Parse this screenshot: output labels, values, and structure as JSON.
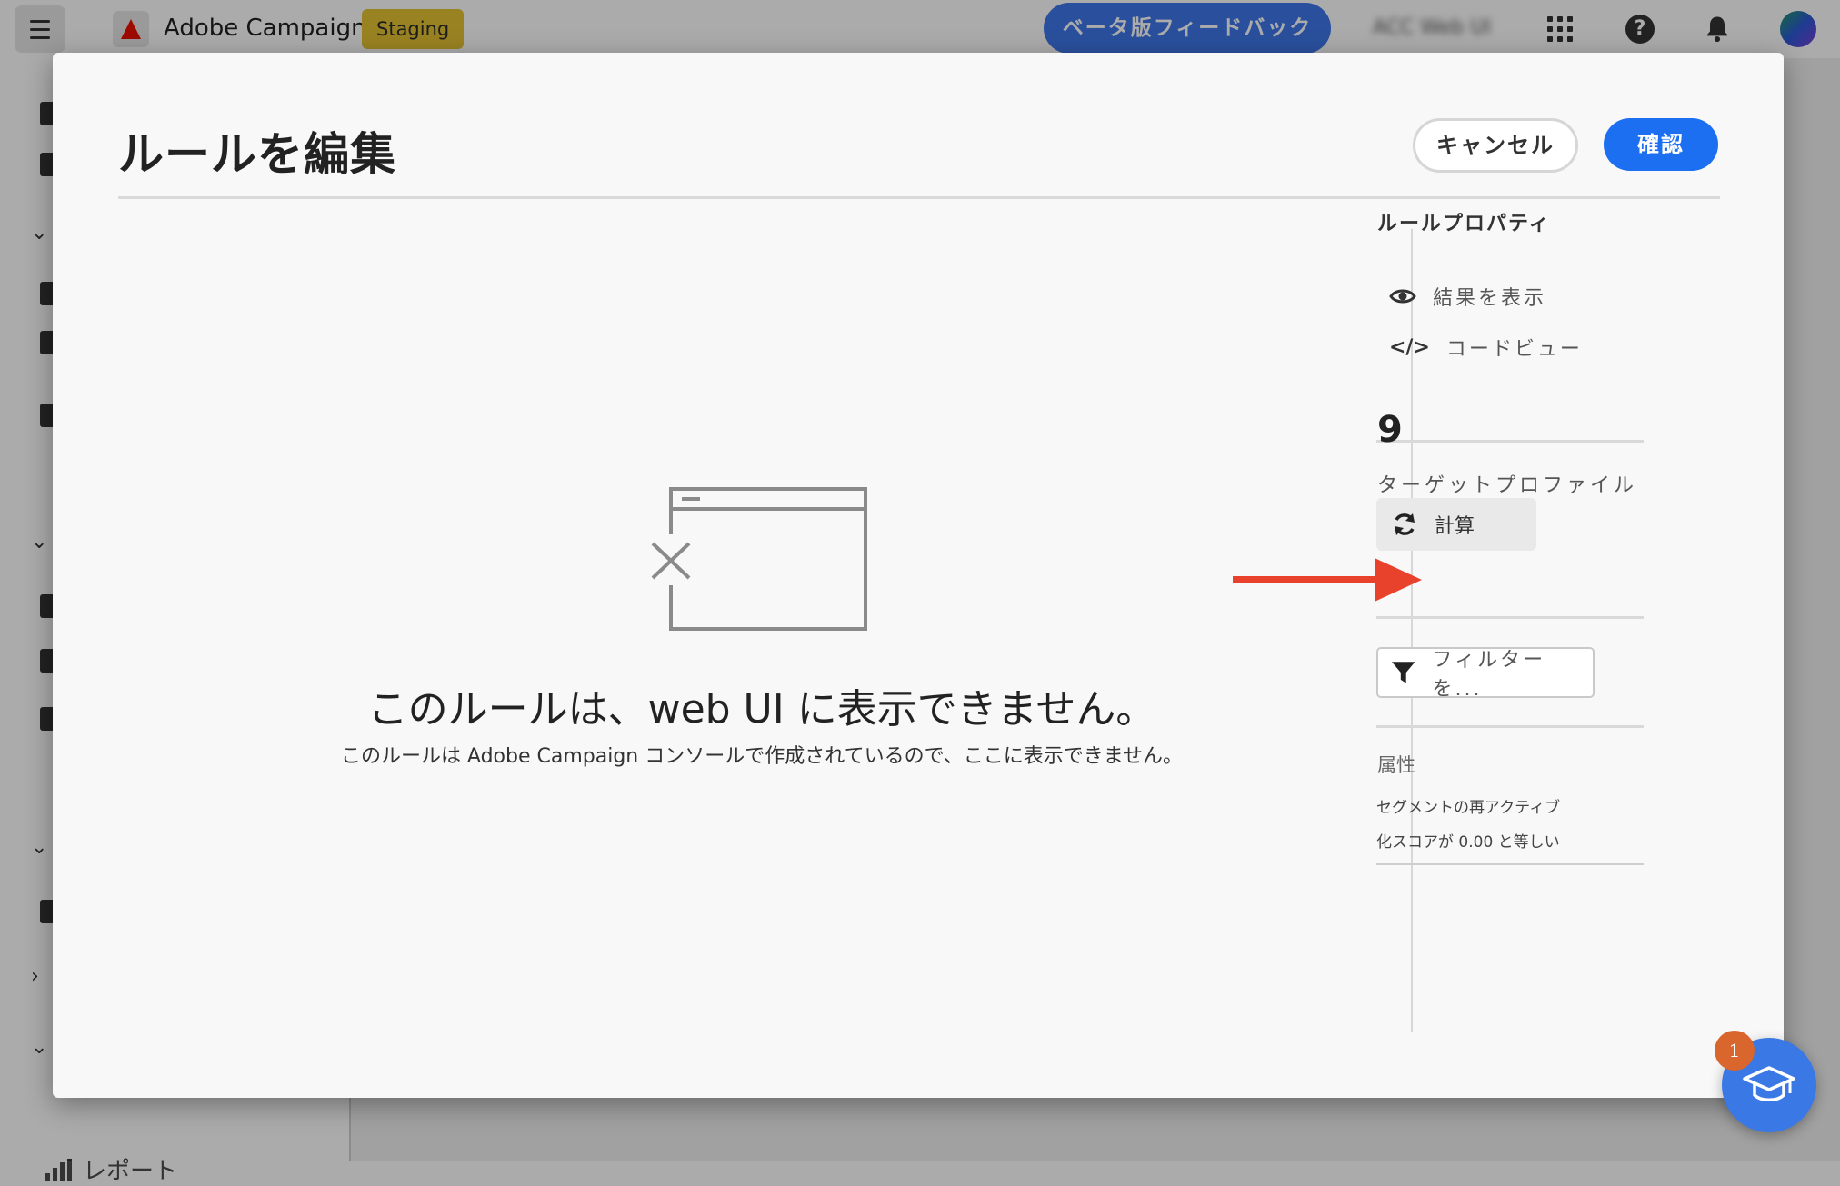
{
  "topbar": {
    "brand_name": "Adobe Campaign",
    "env_badge": "Staging",
    "beta_feedback_label": "ベータ版フィードバック",
    "org_name": "ACC Web UI",
    "icons": [
      "menu-icon",
      "adobe-logo-icon",
      "apps-grid-icon",
      "help-icon",
      "bell-icon",
      "avatar"
    ]
  },
  "leftnav": {
    "report_label": "レポート"
  },
  "dialog": {
    "title": "ルールを編集",
    "cancel_label": "キャンセル",
    "confirm_label": "確認",
    "empty_title": "このルールは、web UI に表示できません。",
    "empty_description": "このルールは Adobe Campaign コンソールで作成されているので、ここに表示できません。"
  },
  "rule_properties": {
    "heading": "ルールプロパティ",
    "view_results_label": "結果を表示",
    "code_view_label": "コードビュー",
    "target_count": "9",
    "target_label": "ターゲットプロファイル",
    "calculate_label": "計算",
    "filter_label": "フィルターを...",
    "attributes_label": "属性",
    "attribute_condition_line1": "セグメントの再アクティブ",
    "attribute_condition_line2": "化スコアが 0.00 と等しい"
  },
  "help_fab": {
    "badge_count": "1"
  },
  "colors": {
    "accent": "#1b6ff0",
    "beta_button": "#3f78ea",
    "staging_badge": "#e5c234",
    "annotation_arrow": "#e8412c",
    "fab_badge": "#d9662d"
  }
}
